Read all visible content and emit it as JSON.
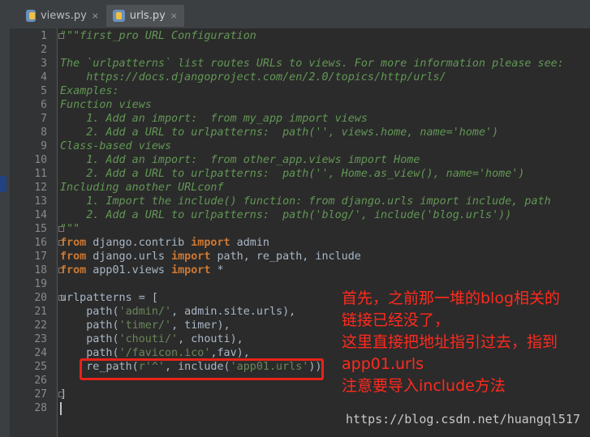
{
  "tabs": [
    {
      "label": "views.py",
      "close": "×",
      "active": false
    },
    {
      "label": "urls.py",
      "close": "×",
      "active": true
    }
  ],
  "line_numbers": [
    "1",
    "2",
    "3",
    "4",
    "5",
    "6",
    "7",
    "8",
    "9",
    "10",
    "11",
    "12",
    "13",
    "14",
    "15",
    "16",
    "17",
    "18",
    "19",
    "20",
    "21",
    "22",
    "23",
    "24",
    "25",
    "26",
    "27",
    "28"
  ],
  "code": {
    "l1": "\"\"\"first_pro URL Configuration",
    "l3": "The `urlpatterns` list routes URLs to views. For more information please see:",
    "l4": "    https://docs.djangoproject.com/en/2.0/topics/http/urls/",
    "l5": "Examples:",
    "l6": "Function views",
    "l7": "    1. Add an import:  from my_app import views",
    "l8": "    2. Add a URL to urlpatterns:  path('', views.home, name='home')",
    "l9": "Class-based views",
    "l10": "    1. Add an import:  from other_app.views import Home",
    "l11": "    2. Add a URL to urlpatterns:  path('', Home.as_view(), name='home')",
    "l12": "Including another URLconf",
    "l13": "    1. Import the include() function: from django.urls import include, path",
    "l14": "    2. Add a URL to urlpatterns:  path('blog/', include('blog.urls'))",
    "l15": "\"\"\"",
    "kw_from": "from",
    "kw_import": "import",
    "l16_mod": " django.contrib ",
    "l16_name": " admin",
    "l17_mod": " django.urls ",
    "l17_name": " path, re_path, include",
    "l18_mod": " app01.views ",
    "l18_name": " *",
    "l20": "urlpatterns = [",
    "l21_a": "    path(",
    "l21_s": "'admin/'",
    "l21_b": ", admin.site.urls),",
    "l22_a": "    path(",
    "l22_s": "'timer/'",
    "l22_b": ", timer),",
    "l23_a": "    path(",
    "l23_s": "'chouti/'",
    "l23_b": ", chouti),",
    "l24_a": "    path(",
    "l24_s": "'/favicon.ico'",
    "l24_b": ",fav),",
    "l25_a": "    re_path(",
    "l25_s1": "r'^'",
    "l25_b": ", include(",
    "l25_s2": "'app01.urls'",
    "l25_c": "))",
    "l27": "]"
  },
  "annotation": [
    "首先，之前那一堆的blog相关的",
    "链接已经没了，",
    "这里直接把地址指引过去，指到",
    "app01.urls",
    "注意要导入include方法"
  ],
  "watermark": "https://blog.csdn.net/huangql517",
  "colors": {
    "annotation": "#ff2a1e",
    "highlight_box": "#e8231a",
    "docstring": "#629755",
    "keyword": "#cc7832"
  }
}
